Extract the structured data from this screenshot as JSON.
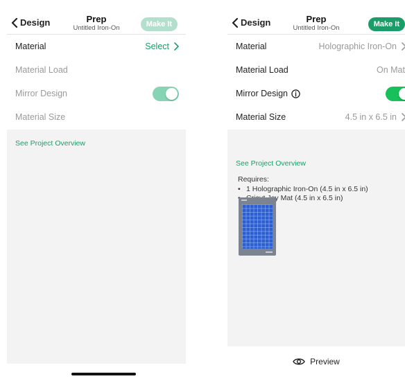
{
  "left_screen": {
    "header": {
      "back_label": "Design",
      "title": "Prep",
      "subtitle": "Untitled Iron-On",
      "make_it_label": "Make It"
    },
    "rows": [
      {
        "label": "Material",
        "value": "Select"
      },
      {
        "label": "Material Load"
      },
      {
        "label": "Mirror Design",
        "toggle_on": true
      },
      {
        "label": "Material Size"
      }
    ],
    "overview_link": "See Project Overview"
  },
  "right_screen": {
    "header": {
      "back_label": "Design",
      "title": "Prep",
      "subtitle": "Untitled Iron-On",
      "make_it_label": "Make It"
    },
    "rows": [
      {
        "label": "Material",
        "value": "Holographic Iron-On"
      },
      {
        "label": "Material Load",
        "value": "On Mat"
      },
      {
        "label": "Mirror Design",
        "toggle_on": true
      },
      {
        "label": "Material Size",
        "value": "4.5 in x 6.5 in"
      }
    ],
    "overview_link": "See Project Overview",
    "requires_label": "Requires:",
    "requirements": [
      "1 Holographic Iron-On (4.5 in x 6.5 in)",
      "Cricut Joy Mat (4.5 in x 6.5 in)"
    ],
    "preview_label": "Preview"
  },
  "colors": {
    "accent": "#1a9d68",
    "make_it_disabled": "#b3e0cd",
    "toggle_on": "#17c05a",
    "toggle_on_disabled": "#86d4b3",
    "panel_bg": "#f3f3f3",
    "mat_blue": "#2d5fd0"
  },
  "icons": [
    "chevron-left-icon",
    "chevron-right-icon",
    "info-icon",
    "eye-icon"
  ]
}
